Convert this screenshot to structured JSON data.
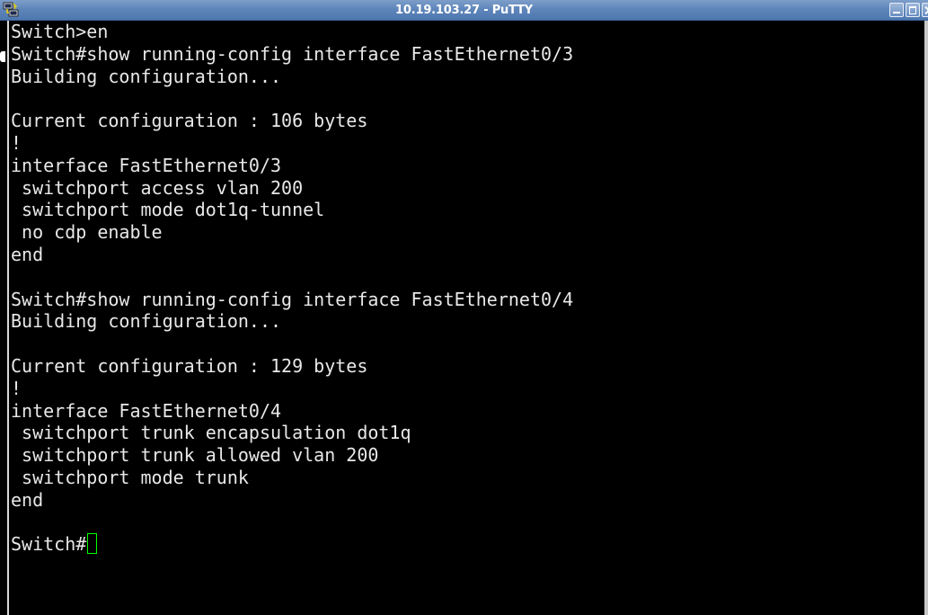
{
  "window": {
    "title": "10.19.103.27 - PuTTY",
    "app_icon": "putty-icon",
    "controls": [
      "minimize-icon",
      "maximize-icon",
      "close-icon"
    ]
  },
  "terminal": {
    "colors": {
      "background": "#000000",
      "foreground": "#e8e8e8",
      "cursor": "#00ff00"
    },
    "lines": [
      "Switch>en",
      "Switch#show running-config interface FastEthernet0/3",
      "Building configuration...",
      "",
      "Current configuration : 106 bytes",
      "!",
      "interface FastEthernet0/3",
      " switchport access vlan 200",
      " switchport mode dot1q-tunnel",
      " no cdp enable",
      "end",
      "",
      "Switch#show running-config interface FastEthernet0/4",
      "Building configuration...",
      "",
      "Current configuration : 129 bytes",
      "!",
      "interface FastEthernet0/4",
      " switchport trunk encapsulation dot1q",
      " switchport trunk allowed vlan 200",
      " switchport mode trunk",
      "end",
      "",
      "Switch#"
    ]
  }
}
